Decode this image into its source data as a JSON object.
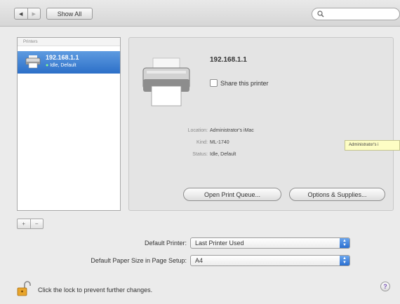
{
  "toolbar": {
    "back_glyph": "◀",
    "forward_glyph": "▶",
    "show_all_label": "Show All",
    "search_placeholder": "",
    "search_icon": "magnifier-icon"
  },
  "printer_list": {
    "header": "Printers",
    "items": [
      {
        "name": "192.168.1.1",
        "status_dot": "●",
        "status": "Idle, Default"
      }
    ],
    "add_label": "+",
    "remove_label": "−"
  },
  "detail": {
    "printer_name": "192.168.1.1",
    "share_label": "Share this printer",
    "share_checked": false,
    "fields": [
      {
        "label": "Location:",
        "value": "Administrator's iMac"
      },
      {
        "label": "Kind:",
        "value": "ML-1740"
      },
      {
        "label": "Status:",
        "value": "Idle, Default"
      }
    ],
    "open_queue_label": "Open Print Queue...",
    "options_label": "Options & Supplies..."
  },
  "tooltip": "Administrator's i",
  "default_printer": {
    "label": "Default Printer:",
    "value": "Last Printer Used"
  },
  "paper_size": {
    "label": "Default Paper Size in Page Setup:",
    "value": "A4"
  },
  "lock_text": "Click the lock to prevent further changes.",
  "help_label": "?",
  "colors": {
    "selection": "#2c6fc8",
    "accent": "#3b82dc"
  }
}
